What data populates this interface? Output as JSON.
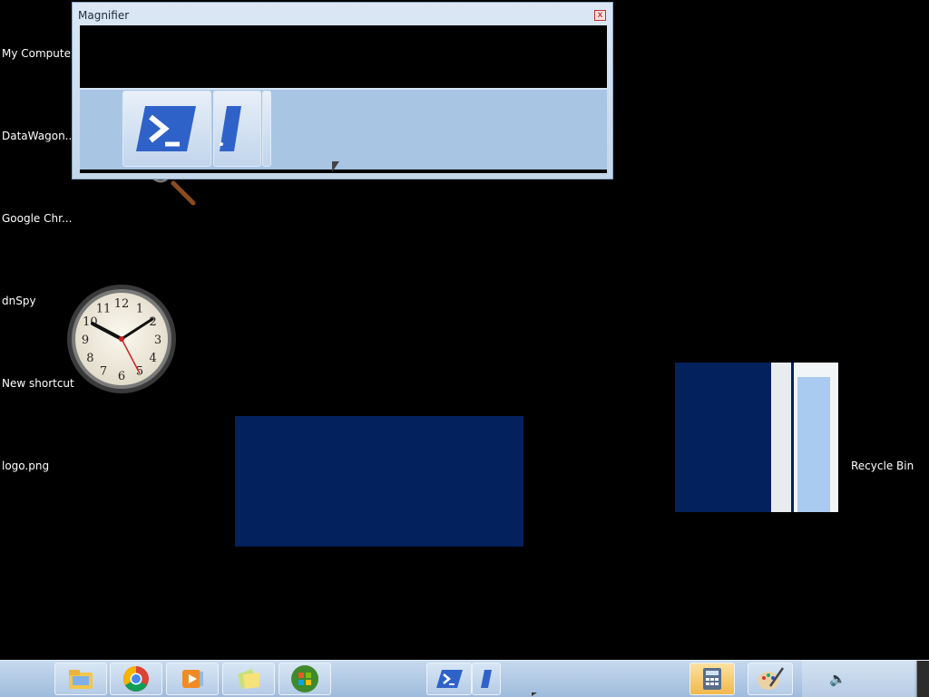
{
  "desktop": {
    "icons": [
      {
        "label": "My Computer"
      },
      {
        "label": "DataWagon...."
      },
      {
        "label": "Google Chr..."
      },
      {
        "label": "dnSpy"
      },
      {
        "label": "New shortcut"
      },
      {
        "label": "logo.png"
      }
    ],
    "recycle_bin": {
      "label": "Recycle Bin"
    }
  },
  "magnifier": {
    "title": "Magnifier",
    "close_glyph": "x"
  },
  "clock": {
    "numbers": [
      "12",
      "1",
      "2",
      "3",
      "4",
      "5",
      "6",
      "7",
      "8",
      "9",
      "10",
      "11"
    ]
  },
  "taskbar": {
    "buttons": [
      {
        "icon": "file-explorer-icon"
      },
      {
        "icon": "chrome-icon"
      },
      {
        "icon": "media-player-icon"
      },
      {
        "icon": "sticky-notes-icon"
      },
      {
        "icon": "windows-start-icon"
      },
      {
        "icon": "powershell-icon"
      },
      {
        "icon": "calculator-icon"
      },
      {
        "icon": "paint-icon"
      }
    ],
    "tray": {
      "volume_icon": "speaker-icon",
      "volume_glyph": "🔈"
    }
  },
  "colors": {
    "desktop": "#000000",
    "window_dark_blue": "#03215c",
    "powershell_blue": "#2f62c9"
  }
}
